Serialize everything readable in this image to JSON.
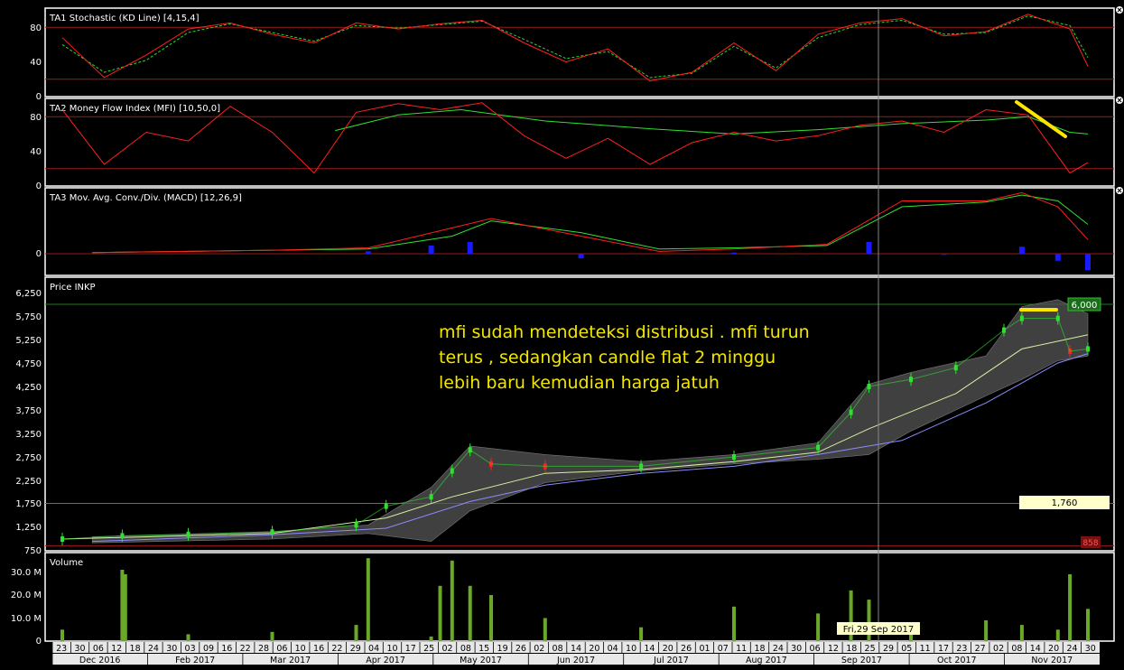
{
  "colors": {
    "background": "#000000",
    "panel_border": "#ffffff",
    "grid": "#9c1a1a",
    "k_line": "#ff2020",
    "d_line": "#20e020",
    "mfi_line": "#ff2020",
    "mfi_signal": "#30e030",
    "macd_line": "#ff2020",
    "macd_signal": "#30e030",
    "macd_hist": "#1a1aff",
    "bollinger_fill": "#555555",
    "ma_short": "#d6f0a0",
    "ma_long": "#8c8cff",
    "candle_up": "#30e030",
    "candle_down": "#ff2020",
    "volume": "#6aa82a",
    "annotation": "#ffe600",
    "note_text": "#f3e600"
  },
  "panels": {
    "stoch": {
      "title": "TA1 Stochastic (KD Line) [4,15,4]",
      "ticks": [
        "80",
        "40",
        "0"
      ]
    },
    "mfi": {
      "title": "TA2 Money Flow Index (MFI) [10,50,0]",
      "ticks": [
        "80",
        "40",
        "0"
      ]
    },
    "macd": {
      "title": "TA3 Mov. Avg. Conv./Div. (MACD) [12,26,9]",
      "ticks": [
        "0"
      ]
    },
    "price": {
      "title": "Price INKP",
      "ticks": [
        "6,250",
        "5,750",
        "5,250",
        "4,750",
        "4,250",
        "3,750",
        "3,250",
        "2,750",
        "2,250",
        "1,750",
        "1,250",
        "750"
      ],
      "label_top": "6,000",
      "label_mid": "1,760",
      "label_low": "858"
    },
    "volume": {
      "title": "Volume",
      "ticks": [
        "30.0 M",
        "20.0 M",
        "10.0 M",
        "0"
      ]
    }
  },
  "annotation": {
    "note": "mfi sudah mendeteksi distribusi . mfi turun terus , sedangkan candle flat 2 minggu lebih baru kemudian harga jatuh",
    "crosshair_label": "Fri,29 Sep 2017"
  },
  "axis": {
    "days": [
      "23",
      "30",
      "06",
      "12",
      "18",
      "24",
      "30",
      "03",
      "09",
      "16",
      "22",
      "28",
      "06",
      "10",
      "16",
      "22",
      "29",
      "04",
      "10",
      "17",
      "25",
      "02",
      "08",
      "15",
      "19",
      "26",
      "02",
      "08",
      "14",
      "20",
      "04",
      "10",
      "14",
      "20",
      "26",
      "01",
      "07",
      "11",
      "18",
      "24",
      "30",
      "06",
      "12",
      "18",
      "25",
      "29",
      "05",
      "11",
      "17",
      "23",
      "27",
      "02",
      "08",
      "14",
      "20",
      "24",
      "30"
    ],
    "months": [
      "Dec 2016",
      "Feb 2017",
      "Mar 2017",
      "Apr 2017",
      "May 2017",
      "Jun 2017",
      "Jul 2017",
      "Aug 2017",
      "Sep 2017",
      "Oct 2017",
      "Nov 2017"
    ]
  },
  "chart_data": [
    {
      "type": "line",
      "title": "TA1 Stochastic (KD Line) [4,15,4]",
      "ylim": [
        0,
        100
      ],
      "reference_lines": [
        80,
        20
      ],
      "series": [
        {
          "name": "K",
          "x": [
            "2016-12-23",
            "2017-01-06",
            "2017-01-20",
            "2017-02-03",
            "2017-02-17",
            "2017-03-03",
            "2017-03-17",
            "2017-03-31",
            "2017-04-14",
            "2017-04-28",
            "2017-05-12",
            "2017-05-26",
            "2017-06-09",
            "2017-06-23",
            "2017-07-07",
            "2017-07-21",
            "2017-08-04",
            "2017-08-18",
            "2017-09-01",
            "2017-09-15",
            "2017-09-29",
            "2017-10-13",
            "2017-10-27",
            "2017-11-10",
            "2017-11-24",
            "2017-11-30"
          ],
          "values": [
            68,
            22,
            48,
            78,
            85,
            72,
            62,
            85,
            78,
            84,
            88,
            62,
            40,
            55,
            18,
            28,
            62,
            30,
            72,
            85,
            90,
            70,
            75,
            95,
            78,
            35
          ]
        },
        {
          "name": "D",
          "x": [
            "2016-12-23",
            "2017-01-06",
            "2017-01-20",
            "2017-02-03",
            "2017-02-17",
            "2017-03-03",
            "2017-03-17",
            "2017-03-31",
            "2017-04-14",
            "2017-04-28",
            "2017-05-12",
            "2017-05-26",
            "2017-06-09",
            "2017-06-23",
            "2017-07-07",
            "2017-07-21",
            "2017-08-04",
            "2017-08-18",
            "2017-09-01",
            "2017-09-15",
            "2017-09-29",
            "2017-10-13",
            "2017-10-27",
            "2017-11-10",
            "2017-11-24",
            "2017-11-30"
          ],
          "values": [
            60,
            28,
            42,
            74,
            84,
            74,
            64,
            82,
            79,
            83,
            87,
            66,
            44,
            52,
            22,
            27,
            58,
            33,
            68,
            83,
            88,
            72,
            74,
            93,
            82,
            45
          ]
        }
      ]
    },
    {
      "type": "line",
      "title": "TA2 Money Flow Index (MFI) [10,50,0]",
      "ylim": [
        0,
        100
      ],
      "reference_lines": [
        80,
        20
      ],
      "series": [
        {
          "name": "MFI",
          "x": [
            "2016-12-23",
            "2017-01-06",
            "2017-01-20",
            "2017-02-03",
            "2017-02-17",
            "2017-03-03",
            "2017-03-17",
            "2017-03-31",
            "2017-04-14",
            "2017-04-28",
            "2017-05-12",
            "2017-05-26",
            "2017-06-09",
            "2017-06-23",
            "2017-07-07",
            "2017-07-21",
            "2017-08-04",
            "2017-08-18",
            "2017-09-01",
            "2017-09-15",
            "2017-09-29",
            "2017-10-13",
            "2017-10-27",
            "2017-11-10",
            "2017-11-24",
            "2017-11-30"
          ],
          "values": [
            88,
            25,
            62,
            52,
            92,
            62,
            15,
            85,
            95,
            88,
            96,
            58,
            32,
            55,
            25,
            50,
            62,
            52,
            58,
            70,
            75,
            62,
            88,
            82,
            15,
            27
          ]
        },
        {
          "name": "Signal",
          "x": [
            "2017-03-24",
            "2017-04-14",
            "2017-05-05",
            "2017-06-02",
            "2017-07-07",
            "2017-08-04",
            "2017-09-01",
            "2017-09-29",
            "2017-10-27",
            "2017-11-10",
            "2017-11-24",
            "2017-11-30"
          ],
          "values": [
            64,
            82,
            88,
            75,
            66,
            60,
            65,
            72,
            76,
            80,
            62,
            60
          ]
        }
      ]
    },
    {
      "type": "line",
      "title": "TA3 Mov. Avg. Conv./Div. (MACD) [12,26,9]",
      "series": [
        {
          "name": "MACD",
          "x": [
            "2017-01-02",
            "2017-02-03",
            "2017-03-03",
            "2017-04-04",
            "2017-05-02",
            "2017-05-15",
            "2017-06-14",
            "2017-07-10",
            "2017-08-04",
            "2017-09-04",
            "2017-09-29",
            "2017-10-27",
            "2017-11-08",
            "2017-11-20",
            "2017-11-30"
          ],
          "values": [
            1,
            2,
            3,
            5,
            22,
            30,
            15,
            2,
            4,
            8,
            45,
            45,
            52,
            40,
            12
          ]
        },
        {
          "name": "Signal",
          "x": [
            "2017-01-02",
            "2017-02-03",
            "2017-03-03",
            "2017-04-04",
            "2017-05-02",
            "2017-05-15",
            "2017-06-14",
            "2017-07-10",
            "2017-08-04",
            "2017-09-04",
            "2017-09-29",
            "2017-10-27",
            "2017-11-08",
            "2017-11-20",
            "2017-11-30"
          ],
          "values": [
            1,
            2,
            3,
            4,
            15,
            28,
            18,
            4,
            5,
            7,
            40,
            44,
            50,
            45,
            25
          ]
        },
        {
          "name": "Histogram",
          "x": [
            "2017-04-04",
            "2017-04-25",
            "2017-05-08",
            "2017-06-14",
            "2017-08-04",
            "2017-09-18",
            "2017-10-13",
            "2017-11-08",
            "2017-11-20",
            "2017-11-30"
          ],
          "values": [
            2,
            7,
            10,
            -4,
            1,
            10,
            -1,
            6,
            -6,
            -14
          ]
        }
      ]
    },
    {
      "type": "line",
      "title": "Price INKP",
      "ylim": [
        750,
        6250
      ],
      "reference_lines": [
        6000,
        1760,
        858
      ],
      "series": [
        {
          "name": "Close",
          "x": [
            "2016-12-23",
            "2017-01-12",
            "2017-02-03",
            "2017-03-03",
            "2017-03-31",
            "2017-04-10",
            "2017-04-25",
            "2017-05-02",
            "2017-05-08",
            "2017-05-15",
            "2017-06-02",
            "2017-07-04",
            "2017-08-04",
            "2017-09-01",
            "2017-09-12",
            "2017-09-18",
            "2017-10-02",
            "2017-10-17",
            "2017-11-02",
            "2017-11-08",
            "2017-11-20",
            "2017-11-24",
            "2017-11-30"
          ],
          "values": [
            1000,
            1070,
            1100,
            1150,
            1300,
            1700,
            1900,
            2450,
            2900,
            2600,
            2550,
            2550,
            2750,
            2950,
            3700,
            4250,
            4400,
            4650,
            5450,
            5700,
            5700,
            5000,
            5050
          ]
        },
        {
          "name": "MA short",
          "x": [
            "2016-12-23",
            "2017-03-03",
            "2017-04-10",
            "2017-05-02",
            "2017-06-02",
            "2017-07-04",
            "2017-08-04",
            "2017-09-01",
            "2017-09-18",
            "2017-10-17",
            "2017-11-08",
            "2017-11-30"
          ],
          "values": [
            1000,
            1120,
            1450,
            1900,
            2400,
            2480,
            2650,
            2850,
            3350,
            4100,
            5050,
            5350
          ]
        },
        {
          "name": "MA long",
          "x": [
            "2017-01-02",
            "2017-03-03",
            "2017-04-10",
            "2017-05-08",
            "2017-06-02",
            "2017-07-04",
            "2017-08-04",
            "2017-09-01",
            "2017-09-29",
            "2017-10-27",
            "2017-11-20",
            "2017-11-30"
          ],
          "values": [
            950,
            1090,
            1230,
            1800,
            2150,
            2400,
            2550,
            2800,
            3100,
            3900,
            4750,
            4950
          ]
        },
        {
          "name": "Bollinger upper",
          "x": [
            "2017-01-02",
            "2017-03-03",
            "2017-04-04",
            "2017-04-25",
            "2017-05-08",
            "2017-06-02",
            "2017-07-04",
            "2017-08-04",
            "2017-09-01",
            "2017-09-18",
            "2017-10-02",
            "2017-10-27",
            "2017-11-08",
            "2017-11-20",
            "2017-11-30"
          ],
          "values": [
            1050,
            1160,
            1300,
            2100,
            2980,
            2800,
            2650,
            2800,
            3050,
            4300,
            4550,
            4900,
            5950,
            6100,
            5800
          ]
        },
        {
          "name": "Bollinger lower",
          "x": [
            "2017-01-02",
            "2017-03-03",
            "2017-04-04",
            "2017-04-25",
            "2017-05-08",
            "2017-06-02",
            "2017-07-04",
            "2017-08-04",
            "2017-09-01",
            "2017-09-18",
            "2017-10-02",
            "2017-10-27",
            "2017-11-08",
            "2017-11-20",
            "2017-11-30"
          ],
          "values": [
            920,
            1000,
            1120,
            950,
            1600,
            2200,
            2450,
            2600,
            2700,
            2800,
            3300,
            4050,
            4400,
            4800,
            4900
          ]
        }
      ]
    },
    {
      "type": "bar",
      "title": "Volume",
      "ylim": [
        0,
        35
      ],
      "x": [
        "2016-12-23",
        "2017-01-12",
        "2017-01-13",
        "2017-02-03",
        "2017-03-03",
        "2017-03-31",
        "2017-04-04",
        "2017-04-25",
        "2017-04-28",
        "2017-05-02",
        "2017-05-08",
        "2017-05-15",
        "2017-06-02",
        "2017-07-04",
        "2017-08-04",
        "2017-09-01",
        "2017-09-12",
        "2017-09-18",
        "2017-10-02",
        "2017-10-27",
        "2017-11-08",
        "2017-11-20",
        "2017-11-24",
        "2017-11-30"
      ],
      "values": [
        5,
        31,
        29,
        3,
        4,
        7,
        36,
        2,
        24,
        35,
        24,
        20,
        10,
        6,
        15,
        12,
        22,
        18,
        5,
        9,
        7,
        5,
        29,
        14
      ]
    }
  ]
}
